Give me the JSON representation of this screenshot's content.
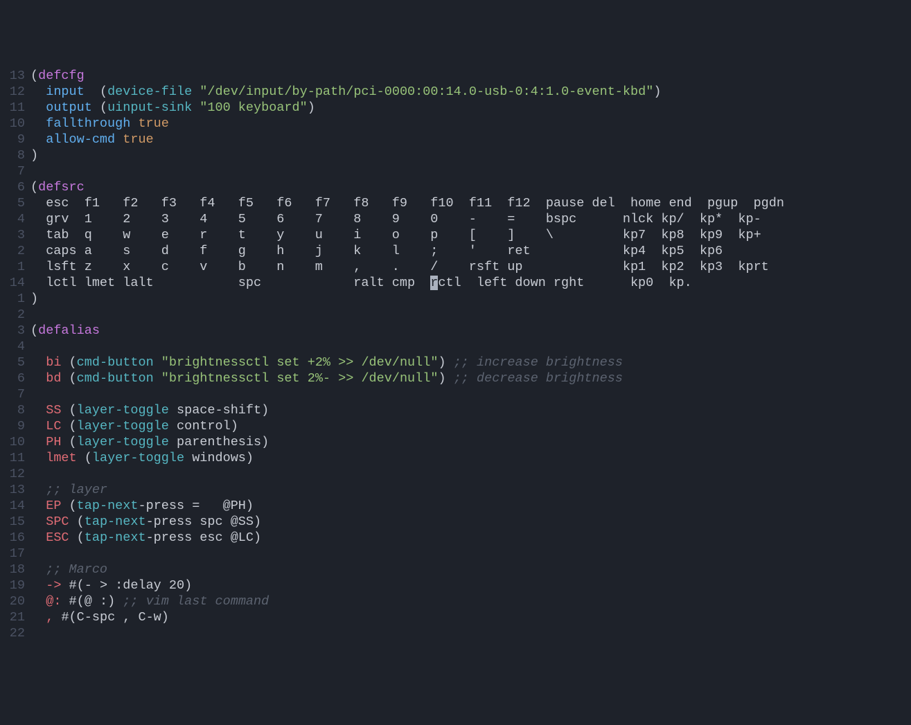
{
  "lines": [
    {
      "n": "13",
      "cells": [
        {
          "t": "(",
          "c": "paren"
        },
        {
          "t": "defcfg",
          "c": "kw"
        }
      ]
    },
    {
      "n": "12",
      "cells": [
        {
          "t": "  "
        },
        {
          "t": "input",
          "c": "sym"
        },
        {
          "t": "  "
        },
        {
          "t": "(",
          "c": "paren"
        },
        {
          "t": "device-file",
          "c": "fn"
        },
        {
          "t": " "
        },
        {
          "t": "\"/dev/input/by-path/pci-0000:00:14.0-usb-0:4:1.0-event-kbd\"",
          "c": "str"
        },
        {
          "t": ")",
          "c": "paren"
        }
      ]
    },
    {
      "n": "11",
      "cells": [
        {
          "t": "  "
        },
        {
          "t": "output",
          "c": "sym"
        },
        {
          "t": " "
        },
        {
          "t": "(",
          "c": "paren"
        },
        {
          "t": "uinput-sink",
          "c": "fn"
        },
        {
          "t": " "
        },
        {
          "t": "\"100 keyboard\"",
          "c": "str"
        },
        {
          "t": ")",
          "c": "paren"
        }
      ]
    },
    {
      "n": "10",
      "cells": [
        {
          "t": "  "
        },
        {
          "t": "fallthrough",
          "c": "sym"
        },
        {
          "t": " "
        },
        {
          "t": "true",
          "c": "const"
        }
      ]
    },
    {
      "n": "9",
      "cells": [
        {
          "t": "  "
        },
        {
          "t": "allow-cmd",
          "c": "sym"
        },
        {
          "t": " "
        },
        {
          "t": "true",
          "c": "const"
        }
      ]
    },
    {
      "n": "8",
      "cells": [
        {
          "t": ")",
          "c": "paren"
        }
      ]
    },
    {
      "n": "7",
      "cells": []
    },
    {
      "n": "6",
      "cells": [
        {
          "t": "(",
          "c": "paren"
        },
        {
          "t": "defsrc",
          "c": "kw"
        }
      ]
    },
    {
      "n": "5",
      "cells": [
        {
          "t": "  esc  f1   f2   f3   f4   f5   f6   f7   f8   f9   f10  f11  f12  pause del  home end  pgup  pgdn",
          "c": "ident"
        }
      ]
    },
    {
      "n": "4",
      "cells": [
        {
          "t": "  grv  1    2    3    4    5    6    7    8    9    0    -    =    bspc      nlck kp/  kp*  kp-",
          "c": "ident"
        }
      ]
    },
    {
      "n": "3",
      "cells": [
        {
          "t": "  tab  q    w    e    r    t    y    u    i    o    p    [    ]    \\         kp7  kp8  kp9  kp+",
          "c": "ident"
        }
      ]
    },
    {
      "n": "2",
      "cells": [
        {
          "t": "  caps a    s    d    f    g    h    j    k    l    ;    '    ret            kp4  kp5  kp6",
          "c": "ident"
        }
      ]
    },
    {
      "n": "1",
      "cells": [
        {
          "t": "  lsft z    x    c    v    b    n    m    ,    .    /    rsft up             kp1  kp2  kp3  kprt",
          "c": "ident"
        }
      ]
    },
    {
      "n": "14",
      "cells": [
        {
          "t": "  lctl lmet lalt           spc            ralt cmp  ",
          "c": "ident"
        },
        {
          "t": "r",
          "c": "ident cursor"
        },
        {
          "t": "ctl  left down rght      kp0  kp.",
          "c": "ident"
        }
      ]
    },
    {
      "n": "1",
      "cells": [
        {
          "t": ")",
          "c": "paren"
        }
      ]
    },
    {
      "n": "2",
      "cells": []
    },
    {
      "n": "3",
      "cells": [
        {
          "t": "(",
          "c": "paren"
        },
        {
          "t": "defalias",
          "c": "kw"
        }
      ]
    },
    {
      "n": "4",
      "cells": []
    },
    {
      "n": "5",
      "cells": [
        {
          "t": "  "
        },
        {
          "t": "bi",
          "c": "red"
        },
        {
          "t": " "
        },
        {
          "t": "(",
          "c": "paren"
        },
        {
          "t": "cmd-button",
          "c": "cyan"
        },
        {
          "t": " "
        },
        {
          "t": "\"brightnessctl set +2% >> /dev/null\"",
          "c": "str"
        },
        {
          "t": ")",
          "c": "paren"
        },
        {
          "t": " "
        },
        {
          "t": ";; increase brightness",
          "c": "comment"
        }
      ]
    },
    {
      "n": "6",
      "cells": [
        {
          "t": "  "
        },
        {
          "t": "bd",
          "c": "red"
        },
        {
          "t": " "
        },
        {
          "t": "(",
          "c": "paren"
        },
        {
          "t": "cmd-button",
          "c": "cyan"
        },
        {
          "t": " "
        },
        {
          "t": "\"brightnessctl set 2%- >> /dev/null\"",
          "c": "str"
        },
        {
          "t": ")",
          "c": "paren"
        },
        {
          "t": " "
        },
        {
          "t": ";; decrease brightness",
          "c": "comment"
        }
      ]
    },
    {
      "n": "7",
      "cells": []
    },
    {
      "n": "8",
      "cells": [
        {
          "t": "  "
        },
        {
          "t": "SS",
          "c": "red"
        },
        {
          "t": " "
        },
        {
          "t": "(",
          "c": "paren"
        },
        {
          "t": "layer-toggle",
          "c": "cyan"
        },
        {
          "t": " space-shift",
          "c": "ident"
        },
        {
          "t": ")",
          "c": "paren"
        }
      ]
    },
    {
      "n": "9",
      "cells": [
        {
          "t": "  "
        },
        {
          "t": "LC",
          "c": "red"
        },
        {
          "t": " "
        },
        {
          "t": "(",
          "c": "paren"
        },
        {
          "t": "layer-toggle",
          "c": "cyan"
        },
        {
          "t": " control",
          "c": "ident"
        },
        {
          "t": ")",
          "c": "paren"
        }
      ]
    },
    {
      "n": "10",
      "cells": [
        {
          "t": "  "
        },
        {
          "t": "PH",
          "c": "red"
        },
        {
          "t": " "
        },
        {
          "t": "(",
          "c": "paren"
        },
        {
          "t": "layer-toggle",
          "c": "cyan"
        },
        {
          "t": " parenthesis",
          "c": "ident"
        },
        {
          "t": ")",
          "c": "paren"
        }
      ]
    },
    {
      "n": "11",
      "cells": [
        {
          "t": "  "
        },
        {
          "t": "lmet",
          "c": "red"
        },
        {
          "t": " "
        },
        {
          "t": "(",
          "c": "paren"
        },
        {
          "t": "layer-toggle",
          "c": "cyan"
        },
        {
          "t": " windows",
          "c": "ident"
        },
        {
          "t": ")",
          "c": "paren"
        }
      ]
    },
    {
      "n": "12",
      "cells": []
    },
    {
      "n": "13",
      "cells": [
        {
          "t": "  "
        },
        {
          "t": ";; layer",
          "c": "comment"
        }
      ]
    },
    {
      "n": "14",
      "cells": [
        {
          "t": "  "
        },
        {
          "t": "EP",
          "c": "red"
        },
        {
          "t": " "
        },
        {
          "t": "(",
          "c": "paren"
        },
        {
          "t": "tap-next",
          "c": "cyan"
        },
        {
          "t": "-press =   @PH",
          "c": "ident"
        },
        {
          "t": ")",
          "c": "paren"
        }
      ]
    },
    {
      "n": "15",
      "cells": [
        {
          "t": "  "
        },
        {
          "t": "SPC",
          "c": "red"
        },
        {
          "t": " "
        },
        {
          "t": "(",
          "c": "paren"
        },
        {
          "t": "tap-next",
          "c": "cyan"
        },
        {
          "t": "-press spc @SS",
          "c": "ident"
        },
        {
          "t": ")",
          "c": "paren"
        }
      ]
    },
    {
      "n": "16",
      "cells": [
        {
          "t": "  "
        },
        {
          "t": "ESC",
          "c": "red"
        },
        {
          "t": " "
        },
        {
          "t": "(",
          "c": "paren"
        },
        {
          "t": "tap-next",
          "c": "cyan"
        },
        {
          "t": "-press esc @LC",
          "c": "ident"
        },
        {
          "t": ")",
          "c": "paren"
        }
      ]
    },
    {
      "n": "17",
      "cells": []
    },
    {
      "n": "18",
      "cells": [
        {
          "t": "  "
        },
        {
          "t": ";; Marco",
          "c": "comment"
        }
      ]
    },
    {
      "n": "19",
      "cells": [
        {
          "t": "  "
        },
        {
          "t": "->",
          "c": "red"
        },
        {
          "t": " "
        },
        {
          "t": "#",
          "c": "ident"
        },
        {
          "t": "(",
          "c": "paren"
        },
        {
          "t": "- > :delay 20",
          "c": "ident"
        },
        {
          "t": ")",
          "c": "paren"
        }
      ]
    },
    {
      "n": "20",
      "cells": [
        {
          "t": "  "
        },
        {
          "t": "@:",
          "c": "red"
        },
        {
          "t": " "
        },
        {
          "t": "#",
          "c": "ident"
        },
        {
          "t": "(",
          "c": "paren"
        },
        {
          "t": "@ :",
          "c": "ident"
        },
        {
          "t": ")",
          "c": "paren"
        },
        {
          "t": " "
        },
        {
          "t": ";; vim last command",
          "c": "comment"
        }
      ]
    },
    {
      "n": "21",
      "cells": [
        {
          "t": "  "
        },
        {
          "t": ",",
          "c": "red"
        },
        {
          "t": " "
        },
        {
          "t": "#",
          "c": "ident"
        },
        {
          "t": "(",
          "c": "paren"
        },
        {
          "t": "C-spc , C-w",
          "c": "ident"
        },
        {
          "t": ")",
          "c": "paren"
        }
      ]
    },
    {
      "n": "22",
      "cells": []
    }
  ]
}
